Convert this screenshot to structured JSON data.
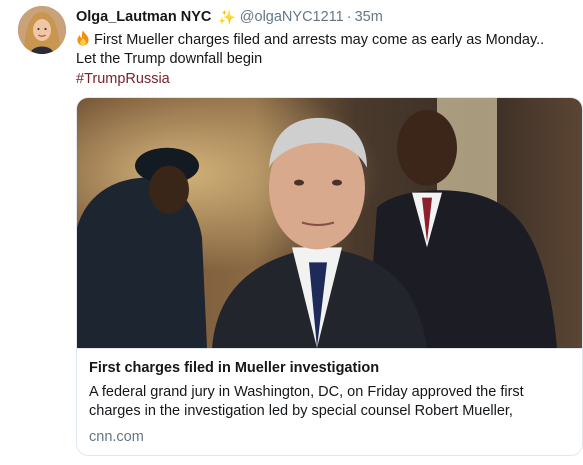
{
  "tweet": {
    "display_name": "Olga_Lautman NYC",
    "handle": "@olgaNYC1211",
    "separator": "·",
    "time": "35m",
    "text": "First Mueller charges filed and arrests may come as early as Monday.. Let the Trump downfall begin",
    "hashtag": "#TrumpRussia"
  },
  "card": {
    "title": "First charges filed in Mueller investigation",
    "description": "A federal grand jury in Washington, DC, on Friday approved the first charges in the investigation led by special counsel Robert Mueller, accordi...",
    "domain": "cnn.com"
  },
  "colors": {
    "hashtag": "#7a1f2b",
    "muted": "#657786",
    "border": "#e1e8ed",
    "sparkle": "#a48bdc"
  },
  "icons": {
    "sparkle": "sparkle-icon",
    "fire": "fire-icon"
  }
}
